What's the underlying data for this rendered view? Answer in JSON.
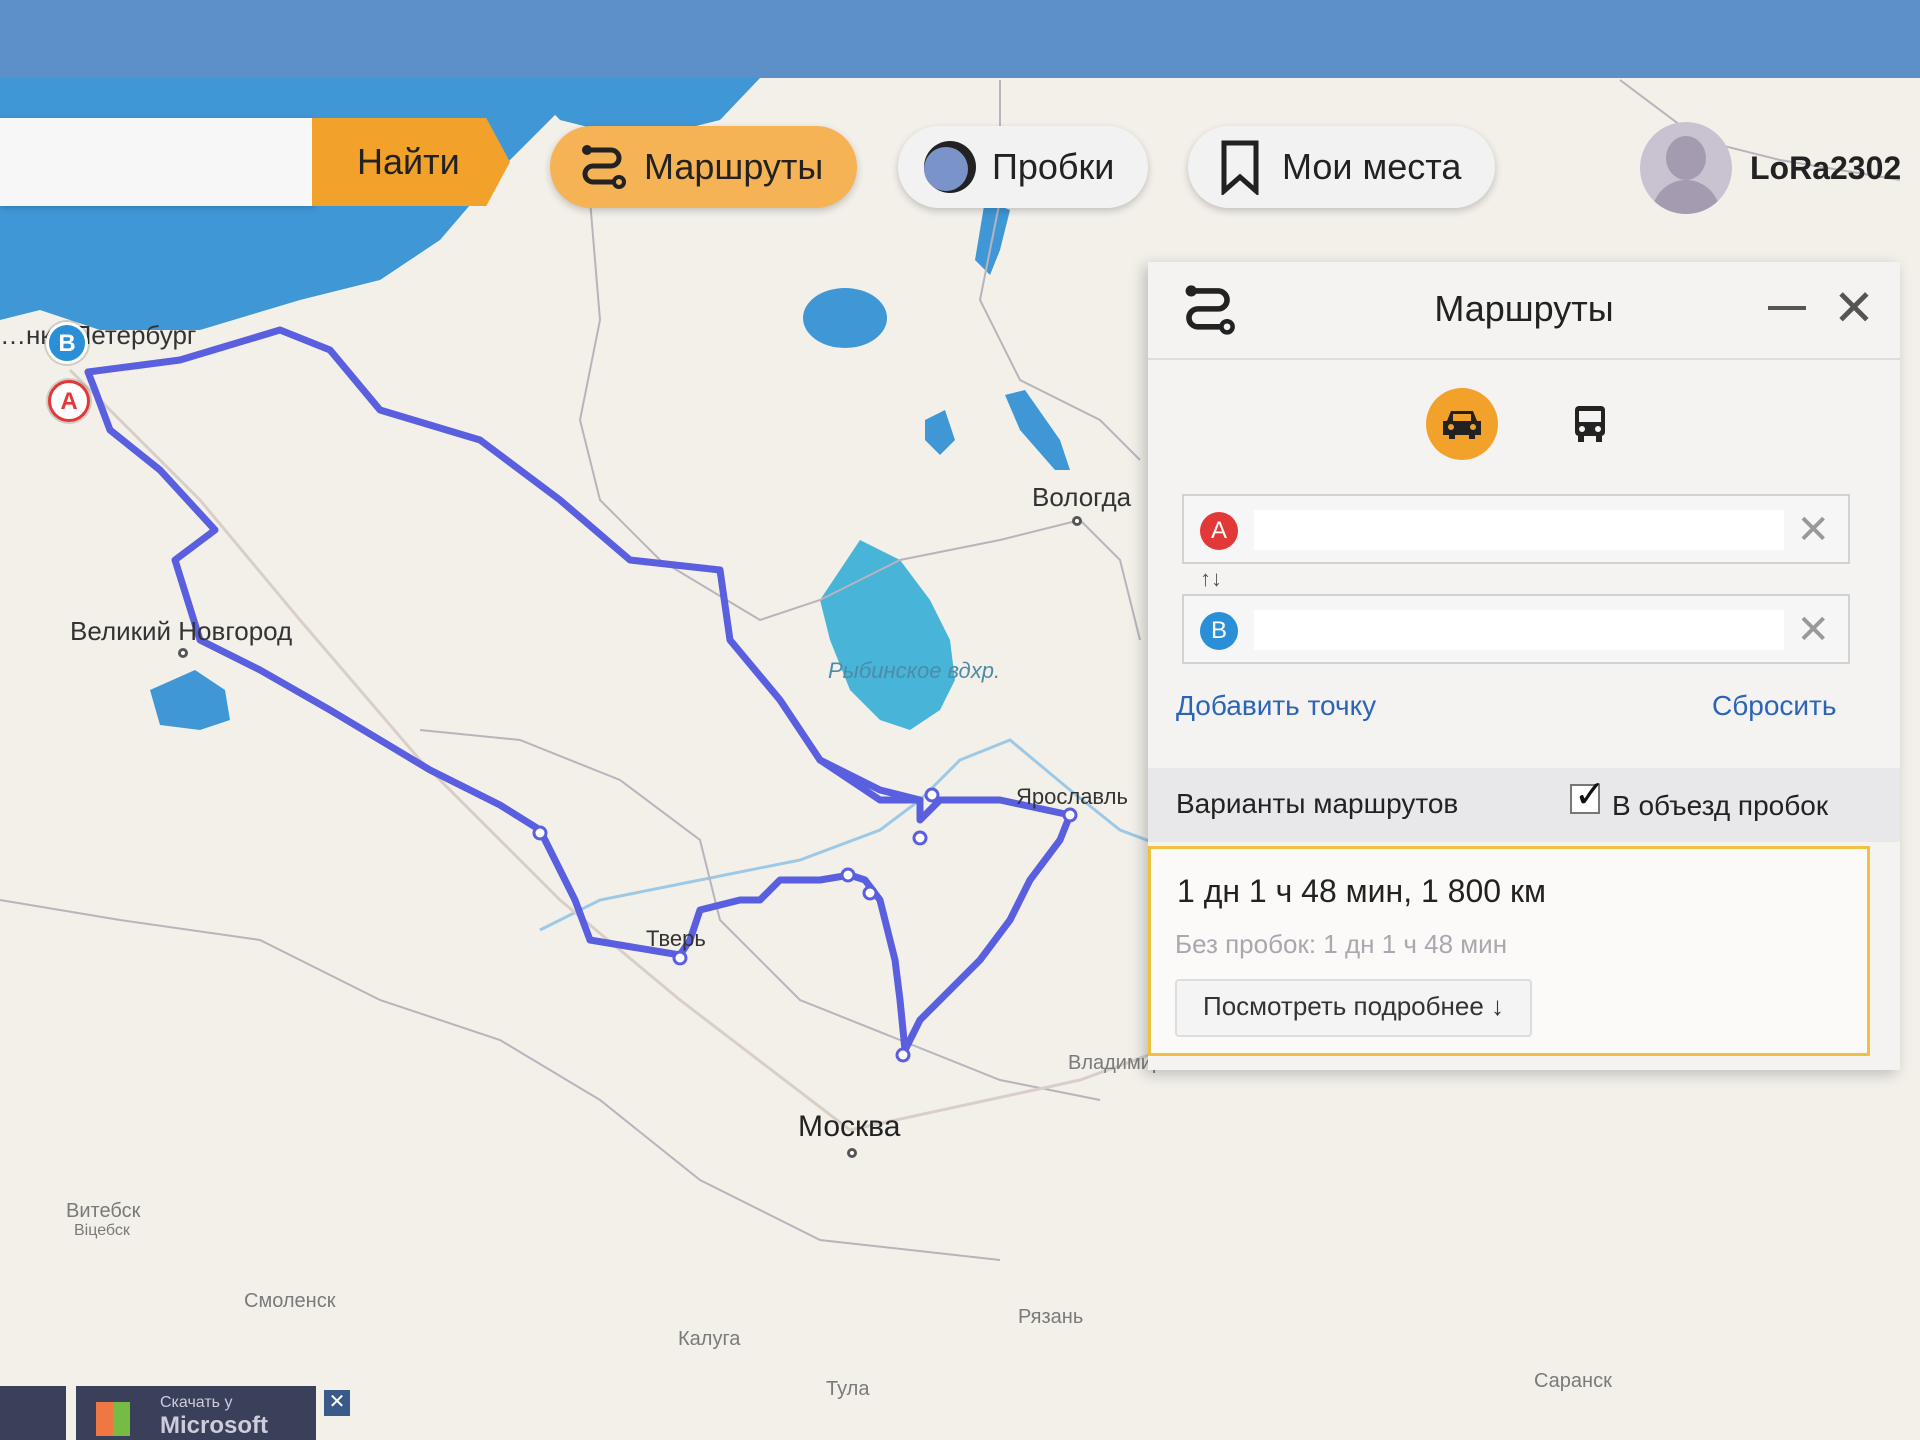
{
  "toolbar": {
    "find_label": "Найти",
    "routes_label": "Маршруты",
    "traffic_label": "Пробки",
    "places_label": "Мои места",
    "username": "LoRa2302"
  },
  "panel": {
    "title": "Маршруты",
    "point_a_marker": "A",
    "point_b_marker": "B",
    "swap_glyph": "↑↓",
    "add_point_label": "Добавить точку",
    "reset_label": "Сбросить",
    "variants_label": "Варианты маршрутов",
    "avoid_traffic_label": "В объезд пробок",
    "avoid_traffic_checked": true,
    "route": {
      "summary": "1 дн 1 ч 48 мин, 1 800 км",
      "no_traffic": "Без пробок: 1 дн 1 ч 48 мин",
      "details_button": "Посмотреть подробнее ↓"
    }
  },
  "map": {
    "cities": {
      "spb": "…нкт-Петербург",
      "novgorod": "Великий Новгород",
      "vologda": "Вологда",
      "yaroslavl": "Ярославль",
      "tver": "Тверь",
      "moscow": "Москва",
      "vladimir": "Владимир",
      "vitebsk": "Витебск",
      "vitebsk_by": "Віцебск",
      "smolensk": "Смоленск",
      "kaluga": "Калуга",
      "tula": "Тула",
      "ryazan": "Рязань",
      "saransk": "Саранск"
    },
    "reservoir": "Рыбинское вдхр.",
    "pin_a": "A",
    "pin_b": "B"
  },
  "colors": {
    "accent_orange": "#f2a22a",
    "route_blue": "#5a5fe0",
    "water": "#3f97d6"
  },
  "banner": {
    "line1": "Скачать у",
    "line2": "Microsoft"
  }
}
